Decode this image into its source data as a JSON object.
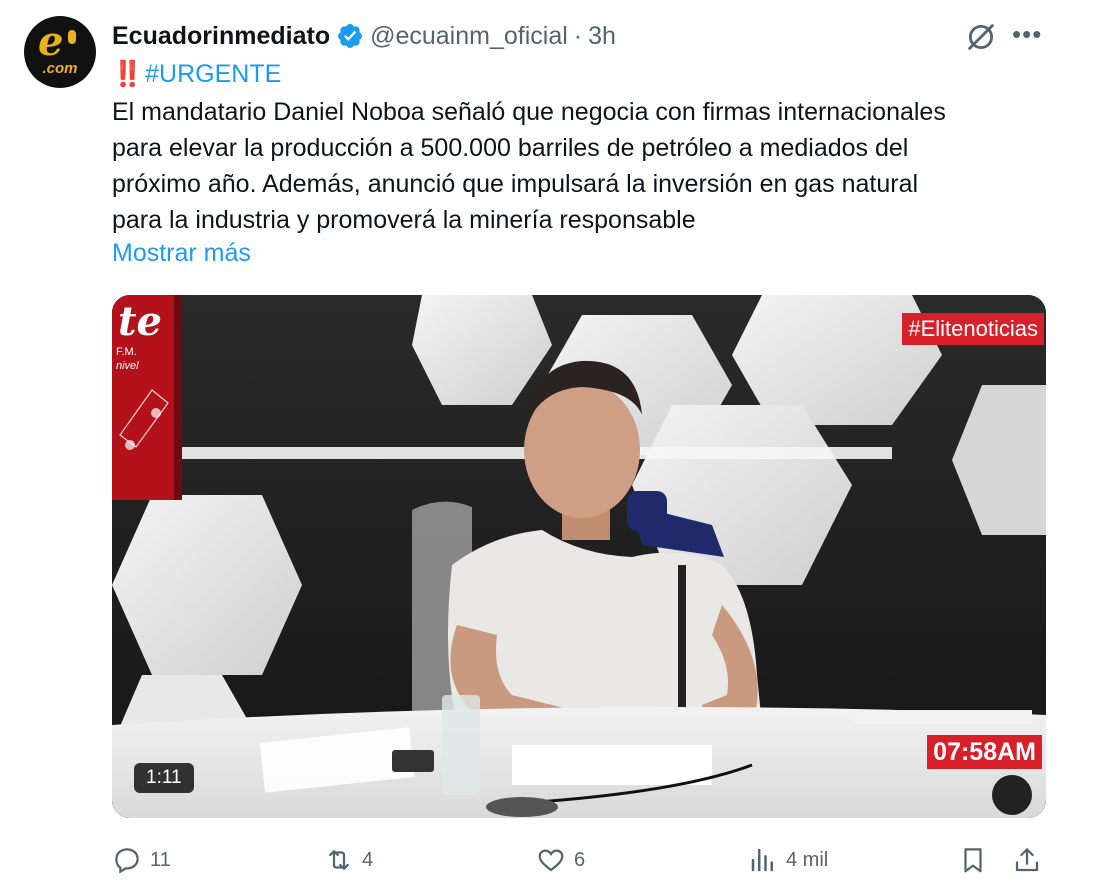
{
  "tweet": {
    "display_name": "Ecuadorinmediato",
    "handle": "@ecuainm_oficial",
    "separator": "·",
    "time": "3h",
    "avatar": {
      "logo_text": "e",
      "domain_text": ".com"
    },
    "hashtag_prefix": "‼️",
    "hashtag": "#URGENTE",
    "body_lines": [
      "El mandatario Daniel Noboa señaló que negocia con firmas internacionales",
      "para elevar la producción a 500.000 barriles de petróleo a mediados del",
      "próximo año. Además, anunció que impulsará la inversión en gas natural",
      "para la industria y promoverá la minería responsable"
    ],
    "show_more": "Mostrar más"
  },
  "media": {
    "overlay_tag": "#Elitenoticias",
    "overlay_clock": "07:58AM",
    "duration": "1:11",
    "backdrop_logo_text": "te",
    "backdrop_logo_subtext": "F.M.",
    "backdrop_logo_subtext2": "nivel"
  },
  "actions": {
    "replies": "11",
    "reposts": "4",
    "likes": "6",
    "views": "4 mil"
  },
  "icons": {
    "verified": "verified-badge-icon",
    "grok": "grok-icon",
    "more": "more-icon",
    "reply": "reply-icon",
    "repost": "repost-icon",
    "like": "like-icon",
    "views": "views-icon",
    "bookmark": "bookmark-icon",
    "share": "share-icon"
  },
  "colors": {
    "accent": "#1d9bf0",
    "text": "#0f1419",
    "muted": "#536471",
    "overlay_red": "#d8202a"
  }
}
